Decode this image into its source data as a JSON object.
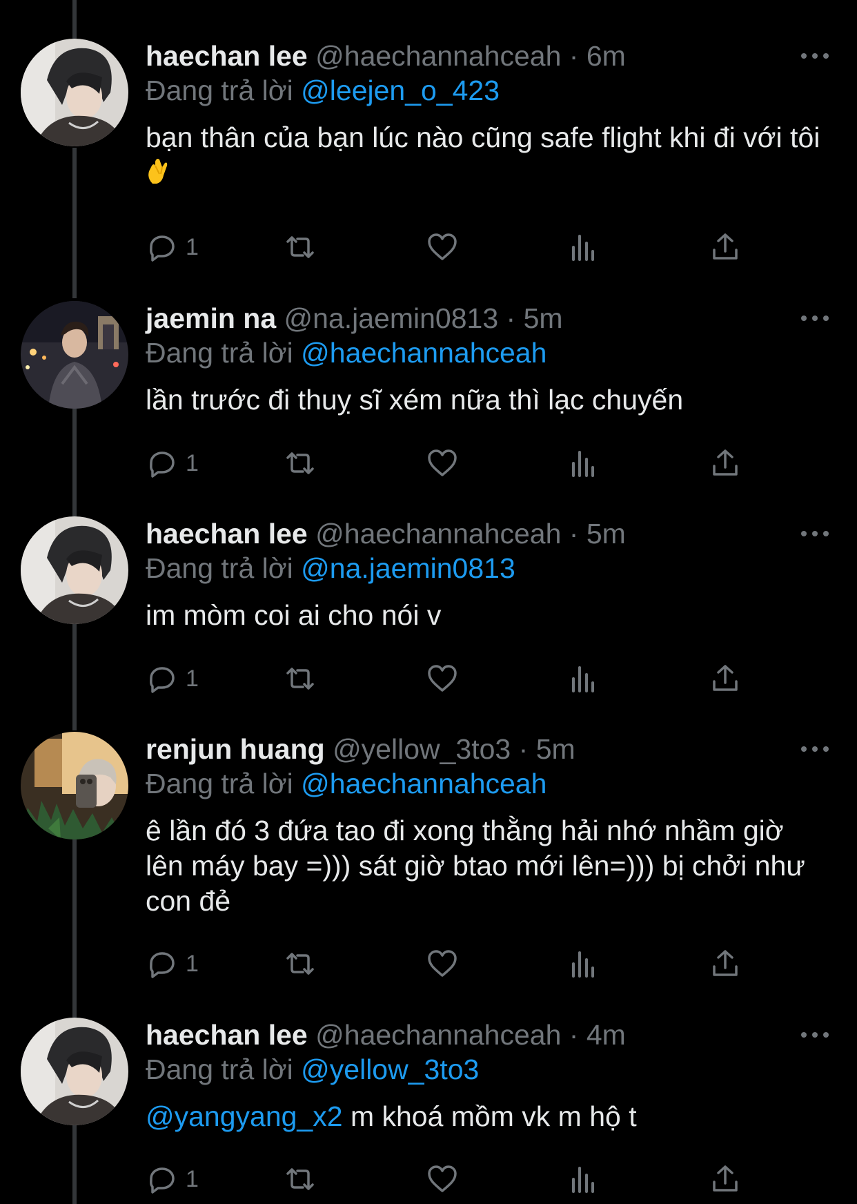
{
  "colors": {
    "background": "#000000",
    "text_primary": "#e7e9ea",
    "text_secondary": "#71767b",
    "accent": "#1d9bf0",
    "thread_line": "#333639"
  },
  "tweets": [
    {
      "display_name": "haechan lee",
      "handle": "@haechannahceah",
      "separator": "·",
      "time": "6m",
      "reply_prefix": "Đang trả lời",
      "reply_to": "@leejen_o_423",
      "body_mention": "",
      "body": "bạn thân của bạn lúc nào cũng safe flight khi đi với tôi",
      "reply_count": "1",
      "avatar": "haechan-avatar",
      "has_emoji": true,
      "emoji": "crossed-fingers-emoji"
    },
    {
      "display_name": "jaemin na",
      "handle": "@na.jaemin0813",
      "separator": "·",
      "time": "5m",
      "reply_prefix": "Đang trả lời",
      "reply_to": "@haechannahceah",
      "body_mention": "",
      "body": "lần trước đi thuỵ sĩ xém nữa thì lạc chuyến",
      "reply_count": "1",
      "avatar": "jaemin-avatar",
      "has_emoji": false
    },
    {
      "display_name": "haechan lee",
      "handle": "@haechannahceah",
      "separator": "·",
      "time": "5m",
      "reply_prefix": "Đang trả lời",
      "reply_to": "@na.jaemin0813",
      "body_mention": "",
      "body": "im mòm coi ai cho nói v",
      "reply_count": "1",
      "avatar": "haechan-avatar",
      "has_emoji": false
    },
    {
      "display_name": "renjun huang",
      "handle": "@yellow_3to3",
      "separator": "·",
      "time": "5m",
      "reply_prefix": "Đang trả lời",
      "reply_to": "@haechannahceah",
      "body_mention": "",
      "body": "ê lần đó 3 đứa tao đi xong thằng hải nhớ nhầm giờ lên máy bay =))) sát giờ btao mới lên=))) bị chởi như con đẻ",
      "reply_count": "1",
      "avatar": "renjun-avatar",
      "has_emoji": false
    },
    {
      "display_name": "haechan lee",
      "handle": "@haechannahceah",
      "separator": "·",
      "time": "4m",
      "reply_prefix": "Đang trả lời",
      "reply_to": "@yellow_3to3",
      "body_mention": "@yangyang_x2",
      "body": "m khoá mồm vk m hộ t",
      "reply_count": "1",
      "avatar": "haechan-avatar",
      "has_emoji": false
    }
  ]
}
